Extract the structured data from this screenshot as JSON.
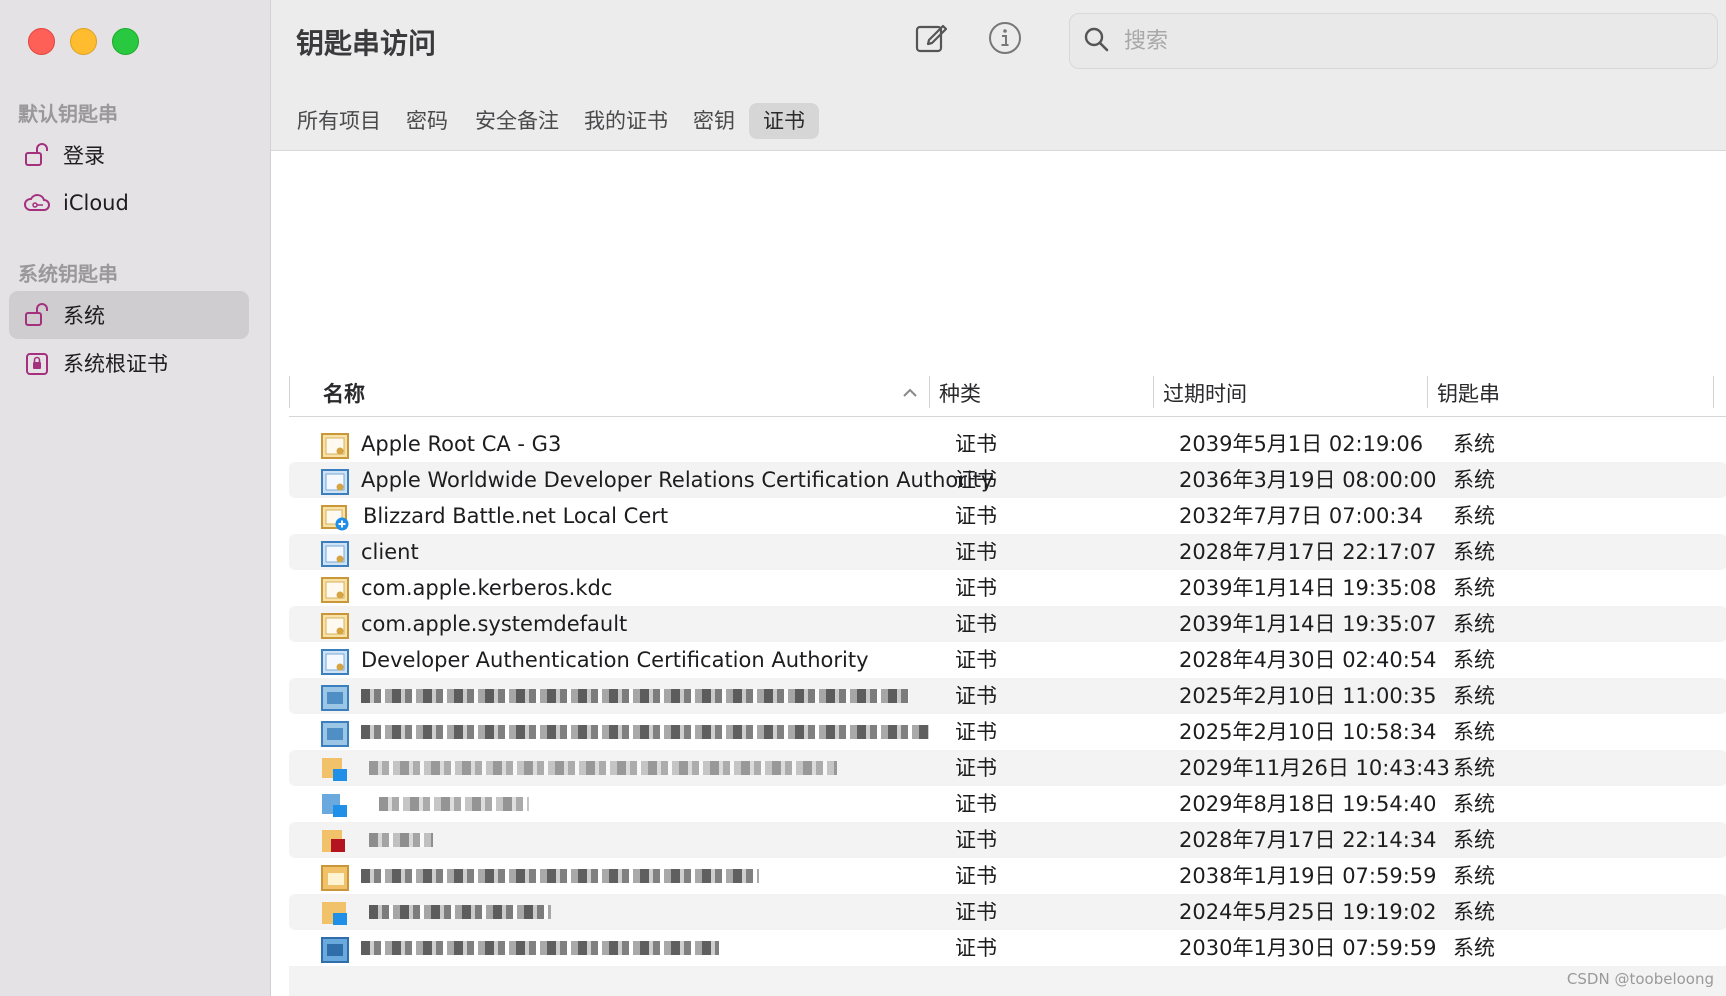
{
  "sidebar": {
    "window_controls": [
      "close",
      "minimize",
      "maximize"
    ],
    "sections": [
      {
        "title": "默认钥匙串"
      },
      {
        "title": "系统钥匙串"
      }
    ],
    "items": [
      {
        "label": "登录",
        "icon": "unlock-icon"
      },
      {
        "label": "iCloud",
        "icon": "cloud-icon"
      },
      {
        "label": "系统",
        "icon": "unlock-icon",
        "selected": true
      },
      {
        "label": "系统根证书",
        "icon": "lock-cabinet-icon"
      }
    ]
  },
  "toolbar": {
    "title": "钥匙串访问",
    "buttons": [
      "compose-icon",
      "info-icon"
    ],
    "search_placeholder": "搜索"
  },
  "tabs": [
    "所有项目",
    "密码",
    "安全备注",
    "我的证书",
    "密钥",
    "证书"
  ],
  "active_tab": "证书",
  "table": {
    "columns": [
      "名称",
      "种类",
      "过期时间",
      "钥匙串"
    ],
    "sort_indicator": "chevron-up",
    "rows": [
      {
        "name": "Apple Root CA - G3",
        "kind": "证书",
        "expires": "2039年5月1日 02:19:06",
        "keychain": "系统",
        "icon": "cert-gold"
      },
      {
        "name": "Apple Worldwide Developer Relations Certification Authority",
        "kind": "证书",
        "expires": "2036年3月19日 08:00:00",
        "keychain": "系统",
        "icon": "cert-blue"
      },
      {
        "name": "Blizzard Battle.net Local Cert",
        "kind": "证书",
        "expires": "2032年7月7日 07:00:34",
        "keychain": "系统",
        "icon": "cert-plus"
      },
      {
        "name": "client",
        "kind": "证书",
        "expires": "2028年7月17日 22:17:07",
        "keychain": "系统",
        "icon": "cert-blue"
      },
      {
        "name": "com.apple.kerberos.kdc",
        "kind": "证书",
        "expires": "2039年1月14日 19:35:08",
        "keychain": "系统",
        "icon": "cert-gold"
      },
      {
        "name": "com.apple.systemdefault",
        "kind": "证书",
        "expires": "2039年1月14日 19:35:07",
        "keychain": "系统",
        "icon": "cert-gold"
      },
      {
        "name": "Developer Authentication Certification Authority",
        "kind": "证书",
        "expires": "2028年4月30日 02:40:54",
        "keychain": "系统",
        "icon": "cert-blue"
      },
      {
        "name": "",
        "kind": "证书",
        "expires": "2025年2月10日 11:00:35",
        "keychain": "系统",
        "icon": "cert-blurred"
      },
      {
        "name": "",
        "kind": "证书",
        "expires": "2025年2月10日 10:58:34",
        "keychain": "系统",
        "icon": "cert-blurred"
      },
      {
        "name": "",
        "kind": "证书",
        "expires": "2029年11月26日 10:43:43",
        "keychain": "系统",
        "icon": "cert-blurred"
      },
      {
        "name": "",
        "kind": "证书",
        "expires": "2029年8月18日 19:54:40",
        "keychain": "系统",
        "icon": "cert-blurred"
      },
      {
        "name": "",
        "kind": "证书",
        "expires": "2028年7月17日 22:14:34",
        "keychain": "系统",
        "icon": "cert-blurred"
      },
      {
        "name": "",
        "kind": "证书",
        "expires": "2038年1月19日 07:59:59",
        "keychain": "系统",
        "icon": "cert-blurred"
      },
      {
        "name": "",
        "kind": "证书",
        "expires": "2024年5月25日 19:19:02",
        "keychain": "系统",
        "icon": "cert-blurred"
      },
      {
        "name": "",
        "kind": "证书",
        "expires": "2030年1月30日 07:59:59",
        "keychain": "系统",
        "icon": "cert-blurred"
      }
    ]
  },
  "watermark": "CSDN @toobeloong",
  "colors": {
    "sidebar_bg": "#e4e2e4",
    "selection": "#cfcdcf",
    "toolbar_bg": "#ececec",
    "accent_purple": "#a4307e"
  }
}
